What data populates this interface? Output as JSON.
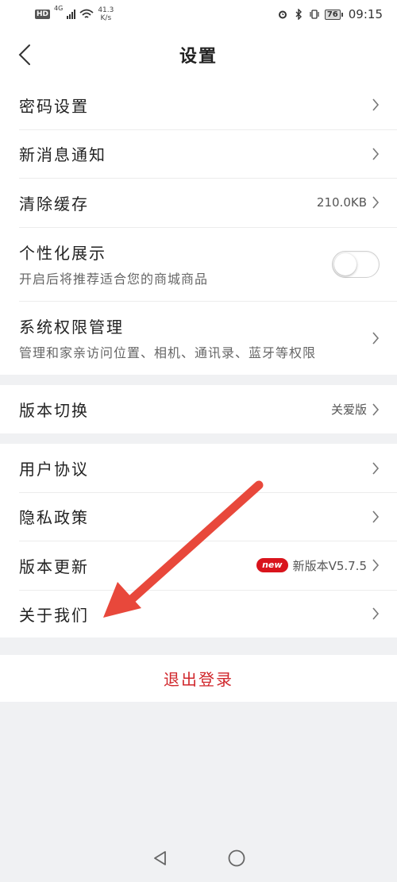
{
  "status_bar": {
    "hd": "HD",
    "network": "4G",
    "speed_value": "41.3",
    "speed_unit": "K/s",
    "battery": "76",
    "time": "09:15"
  },
  "header": {
    "title": "设置"
  },
  "group1": [
    {
      "label": "密码设置"
    },
    {
      "label": "新消息通知"
    },
    {
      "label": "清除缓存",
      "value": "210.0KB"
    },
    {
      "label": "个性化展示",
      "subtitle": "开启后将推荐适合您的商城商品",
      "toggle_on": false
    },
    {
      "label": "系统权限管理",
      "subtitle": "管理和家亲访问位置、相机、通讯录、蓝牙等权限"
    }
  ],
  "group2": [
    {
      "label": "版本切换",
      "value": "关爱版"
    }
  ],
  "group3": [
    {
      "label": "用户协议"
    },
    {
      "label": "隐私政策"
    },
    {
      "label": "版本更新",
      "badge": "new",
      "value": "新版本V5.7.5"
    },
    {
      "label": "关于我们"
    }
  ],
  "logout_label": "退出登录",
  "colors": {
    "accent_red": "#d0262b",
    "badge_red": "#d9141c",
    "arrow_red": "#e8483b"
  }
}
